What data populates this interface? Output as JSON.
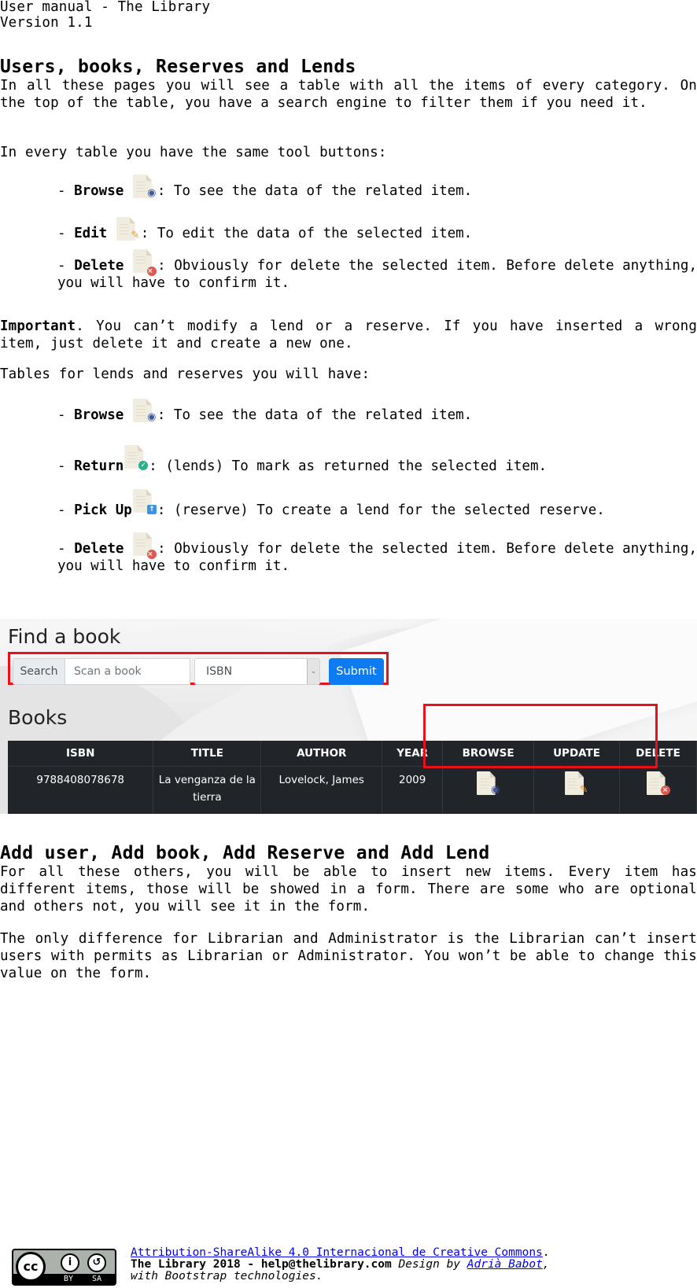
{
  "header": {
    "title": "User manual - The Library",
    "version": "Version 1.1"
  },
  "section1": {
    "heading": "Users, books, Reserves and Lends",
    "intro": "In all these pages you will see a table with all the items of every category. On the top of the table, you have a search engine to filter them if you need it.",
    "tools_intro": "In every table you have the same tool buttons:",
    "tools": [
      {
        "label": "Browse",
        "icon": "document-eye-icon",
        "desc": ": To see the data of the related item."
      },
      {
        "label": "Edit",
        "icon": "document-pencil-icon",
        "desc": ": To edit the data of the selected item."
      },
      {
        "label": "Delete",
        "icon": "document-delete-icon",
        "desc": ": Obviously for delete the selected item. Before delete anything, you will have to confirm it."
      }
    ],
    "important_label": "Important",
    "important_text": ". You can’t modify a lend or a reserve. If you have inserted a wrong item, just delete it and create a new one.",
    "lends_intro": "Tables for lends and reserves you will have:",
    "lend_tools": [
      {
        "label": "Browse",
        "icon": "document-eye-icon",
        "desc": ": To see the data of the related item."
      },
      {
        "label": "Return",
        "icon": "document-check-icon",
        "desc": ": (lends) To mark as returned the selected item."
      },
      {
        "label": "Pick Up",
        "icon": "document-upload-icon",
        "desc": ": (reserve) To create a lend for the selected reserve."
      },
      {
        "label": "Delete",
        "icon": "document-delete-icon",
        "desc": ": Obviously for delete the selected item. Before delete anything, you will have to confirm it."
      }
    ]
  },
  "screenshot": {
    "find_title": "Find a book",
    "search_label": "Search",
    "search_placeholder": "Scan a book",
    "select_value": "ISBN",
    "submit_label": "Submit",
    "books_title": "Books",
    "columns": [
      "ISBN",
      "TITLE",
      "AUTHOR",
      "YEAR",
      "BROWSE",
      "UPDATE",
      "DELETE"
    ],
    "rows": [
      {
        "isbn": "9788408078678",
        "title": "La venganza de la tierra",
        "author": "Lovelock, James",
        "year": "2009"
      }
    ],
    "highlight_color": "#e8101a",
    "submit_color": "#0d7cf2"
  },
  "section2": {
    "heading": "Add user, Add book, Add Reserve and Add Lend",
    "p1": "For all these others, you will be able to insert new items. Every item has different items, those will be showed in a form. There are some who are optional and others not, you will see it in the form.",
    "p2": "The only difference for Librarian and Administrator is the Librarian can’t insert users with permits as Librarian or Administrator. You won’t be able to change this value on the form."
  },
  "footer": {
    "cc_badge": {
      "cc": "cc",
      "by": "BY",
      "sa": "SA"
    },
    "license_link": "Attribution-ShareAlike 4.0 Internacional de Creative Commons",
    "license_suffix": ".",
    "copyright": "The Library 2018 - help@thelibrary.com",
    "design_by": " Design by ",
    "author_link": "Adrià Babot",
    "author_suffix": ",",
    "tech": "with Bootstrap technologies."
  }
}
